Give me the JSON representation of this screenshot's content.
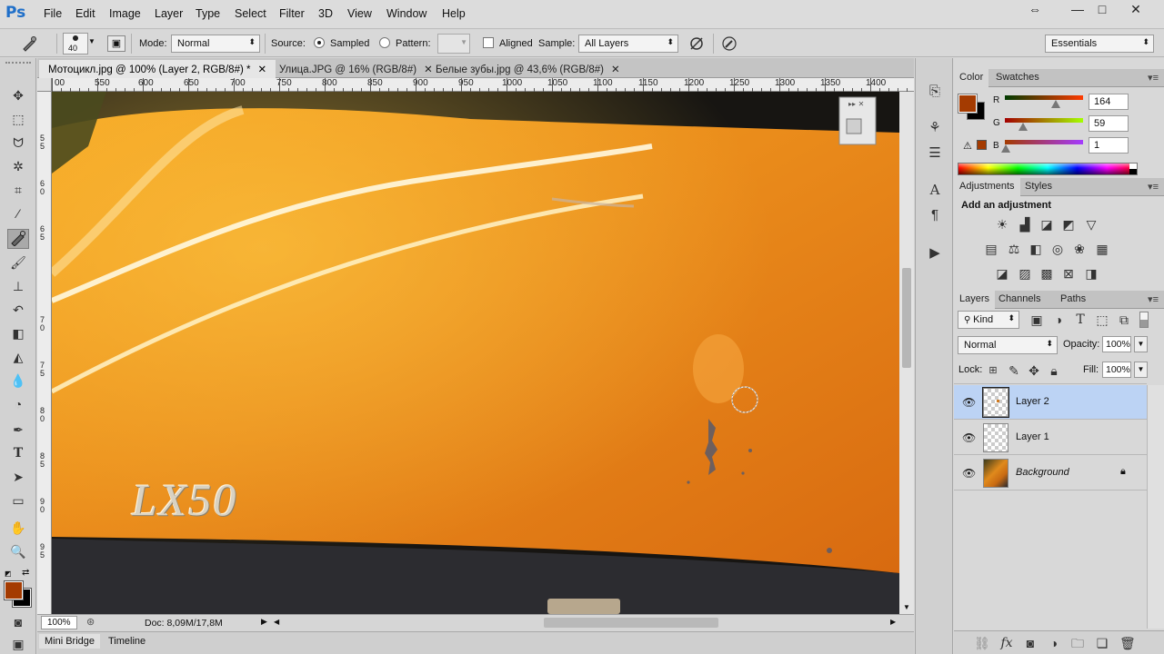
{
  "app": {
    "logo": "Ps",
    "menu": [
      "File",
      "Edit",
      "Image",
      "Layer",
      "Type",
      "Select",
      "Filter",
      "3D",
      "View",
      "Window",
      "Help"
    ],
    "window_controls": [
      "⇔",
      "—",
      "□",
      "✕"
    ]
  },
  "options": {
    "brush_size": "40",
    "mode_label": "Mode:",
    "mode_value": "Normal",
    "source_label": "Source:",
    "sampled_label": "Sampled",
    "pattern_label": "Pattern:",
    "aligned_label": "Aligned",
    "sample_label": "Sample:",
    "sample_value": "All Layers",
    "workspace": "Essentials"
  },
  "tabs": [
    {
      "label": "Мотоцикл.jpg @ 100% (Layer 2, RGB/8#) *",
      "close": "✕"
    },
    {
      "label": "Улица.JPG @ 16% (RGB/8#)",
      "close": "✕"
    },
    {
      "label": "Белые зубы.jpg @ 43,6% (RGB/8#)",
      "close": "✕"
    }
  ],
  "ruler": {
    "top": [
      "00",
      "550",
      "600",
      "650",
      "700",
      "750",
      "800",
      "850",
      "900",
      "950",
      "1000",
      "1050",
      "1100",
      "1150",
      "1200",
      "1250",
      "1300",
      "1350",
      "1400"
    ],
    "left": [
      "5",
      "5",
      "6",
      "0",
      "6",
      "5",
      "7",
      "0",
      "7",
      "5",
      "8",
      "0",
      "8",
      "5",
      "9",
      "0",
      "9",
      "5"
    ]
  },
  "canvas": {
    "text": "LX50"
  },
  "status": {
    "zoom": "100%",
    "doc": "Doc: 8,09M/17,8M"
  },
  "bottom_tabs": [
    "Mini Bridge",
    "Timeline"
  ],
  "color_panel": {
    "tabs": [
      "Color",
      "Swatches"
    ],
    "r_label": "R",
    "r_value": "164",
    "g_label": "G",
    "g_value": "59",
    "b_label": "B",
    "b_value": "1",
    "fg": "#a43b01",
    "bg": "#000000"
  },
  "adjustments_panel": {
    "tabs": [
      "Adjustments",
      "Styles"
    ],
    "title": "Add an adjustment"
  },
  "layers_panel": {
    "tabs": [
      "Layers",
      "Channels",
      "Paths"
    ],
    "kind_label": "Kind",
    "blend_mode": "Normal",
    "opacity_label": "Opacity:",
    "opacity_value": "100%",
    "lock_label": "Lock:",
    "fill_label": "Fill:",
    "fill_value": "100%",
    "layers": [
      {
        "name": "Layer 2",
        "selected": true
      },
      {
        "name": "Layer 1",
        "selected": false
      },
      {
        "name": "Background",
        "selected": false
      }
    ]
  }
}
